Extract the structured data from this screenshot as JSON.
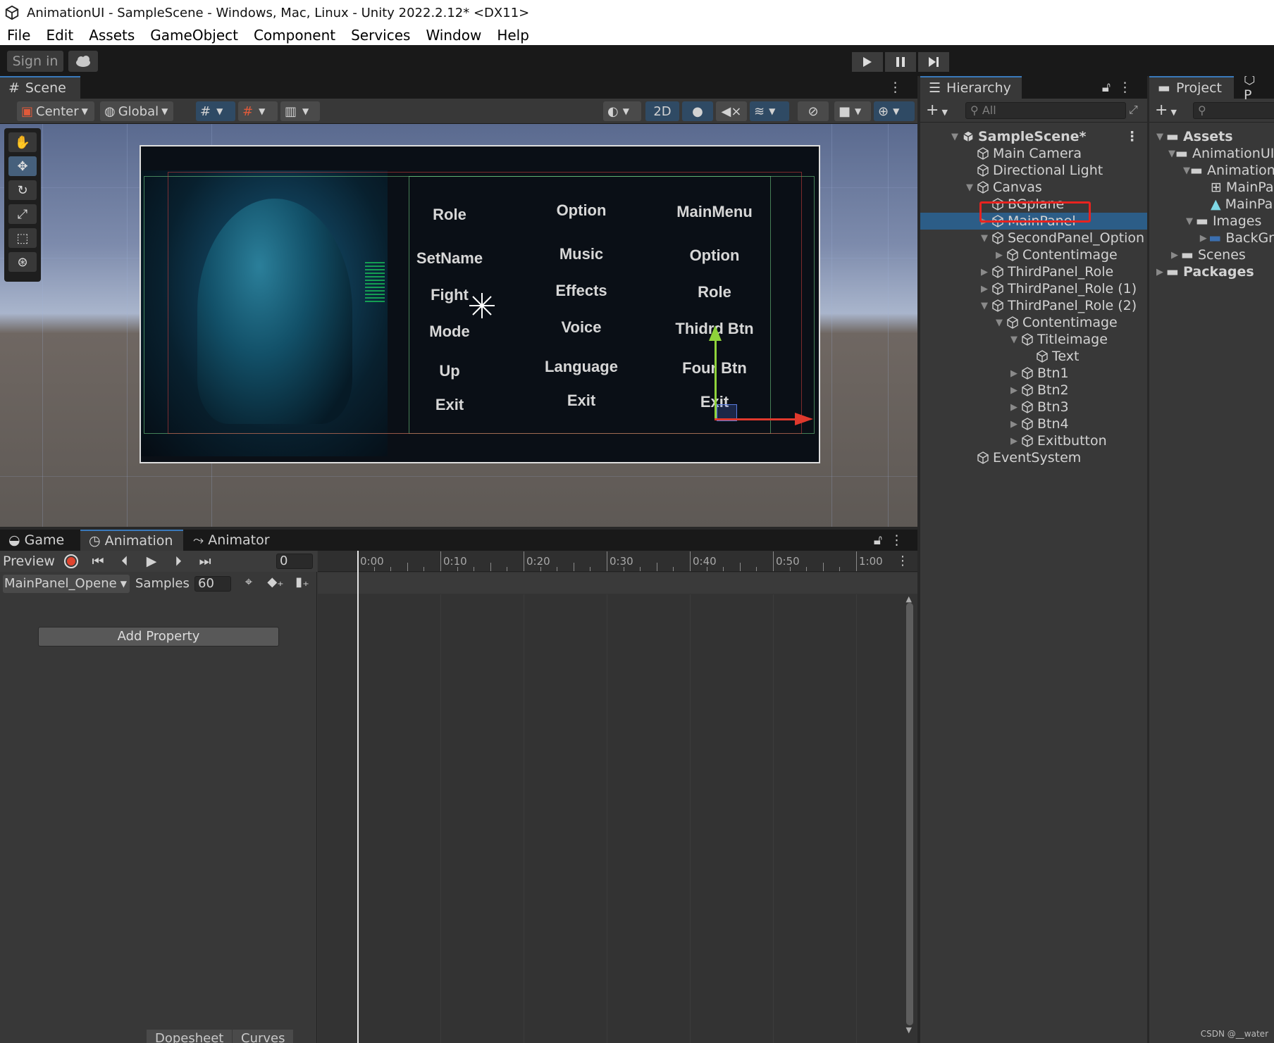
{
  "window": {
    "title": "AnimationUI - SampleScene - Windows, Mac, Linux - Unity 2022.2.12* <DX11>"
  },
  "menu": [
    "File",
    "Edit",
    "Assets",
    "GameObject",
    "Component",
    "Services",
    "Window",
    "Help"
  ],
  "toolbar": {
    "sign_in": "Sign in"
  },
  "scene": {
    "tab": "Scene",
    "pivot": "Center",
    "space": "Global",
    "mode_2d": "2D",
    "columns": [
      [
        "Role",
        "SetName",
        "Fight",
        "Mode",
        "Up",
        "Exit"
      ],
      [
        "Option",
        "Music",
        "Effects",
        "Voice",
        "Language",
        "Exit"
      ],
      [
        "MainMenu",
        "Option",
        "Role",
        "Thidrd Btn",
        "Four Btn",
        "Exit"
      ]
    ]
  },
  "hierarchy": {
    "tab": "Hierarchy",
    "search_placeholder": "All",
    "items": [
      {
        "label": "SampleScene*",
        "depth": 0
      },
      {
        "label": "Main Camera",
        "depth": 1
      },
      {
        "label": "Directional Light",
        "depth": 1
      },
      {
        "label": "Canvas",
        "depth": 1
      },
      {
        "label": "BGplane",
        "depth": 2
      },
      {
        "label": "MainPanel",
        "depth": 2
      },
      {
        "label": "SecondPanel_Option",
        "depth": 2
      },
      {
        "label": "Contentimage",
        "depth": 3
      },
      {
        "label": "ThirdPanel_Role",
        "depth": 2
      },
      {
        "label": "ThirdPanel_Role (1)",
        "depth": 2
      },
      {
        "label": "ThirdPanel_Role (2)",
        "depth": 2
      },
      {
        "label": "Contentimage",
        "depth": 3
      },
      {
        "label": "Titleimage",
        "depth": 4
      },
      {
        "label": "Text",
        "depth": 5
      },
      {
        "label": "Btn1",
        "depth": 4
      },
      {
        "label": "Btn2",
        "depth": 4
      },
      {
        "label": "Btn3",
        "depth": 4
      },
      {
        "label": "Btn4",
        "depth": 4
      },
      {
        "label": "Exitbutton",
        "depth": 4
      },
      {
        "label": "EventSystem",
        "depth": 1
      }
    ]
  },
  "project": {
    "tab": "Project",
    "items": [
      {
        "label": "Assets",
        "depth": 0
      },
      {
        "label": "AnimationUI",
        "depth": 1
      },
      {
        "label": "Animation",
        "depth": 2
      },
      {
        "label": "MainPa",
        "depth": 3
      },
      {
        "label": "MainPa",
        "depth": 3
      },
      {
        "label": "Images",
        "depth": 2
      },
      {
        "label": "BackGr",
        "depth": 3
      },
      {
        "label": "Scenes",
        "depth": 1
      },
      {
        "label": "Packages",
        "depth": 0
      }
    ]
  },
  "animation": {
    "tabs": [
      "Game",
      "Animation",
      "Animator"
    ],
    "preview": "Preview",
    "frame": "0",
    "clip": "MainPanel_Opene",
    "samples_label": "Samples",
    "samples": "60",
    "add_property": "Add Property",
    "bottom_tabs": [
      "Dopesheet",
      "Curves"
    ],
    "ruler": [
      "0:00",
      "0:10",
      "0:20",
      "0:30",
      "0:40",
      "0:50",
      "1:00"
    ]
  },
  "watermark": "CSDN @__water",
  "colors": {
    "selection": "#2c5d87",
    "highlight": "#e8231f",
    "accent": "#3a79bb"
  }
}
